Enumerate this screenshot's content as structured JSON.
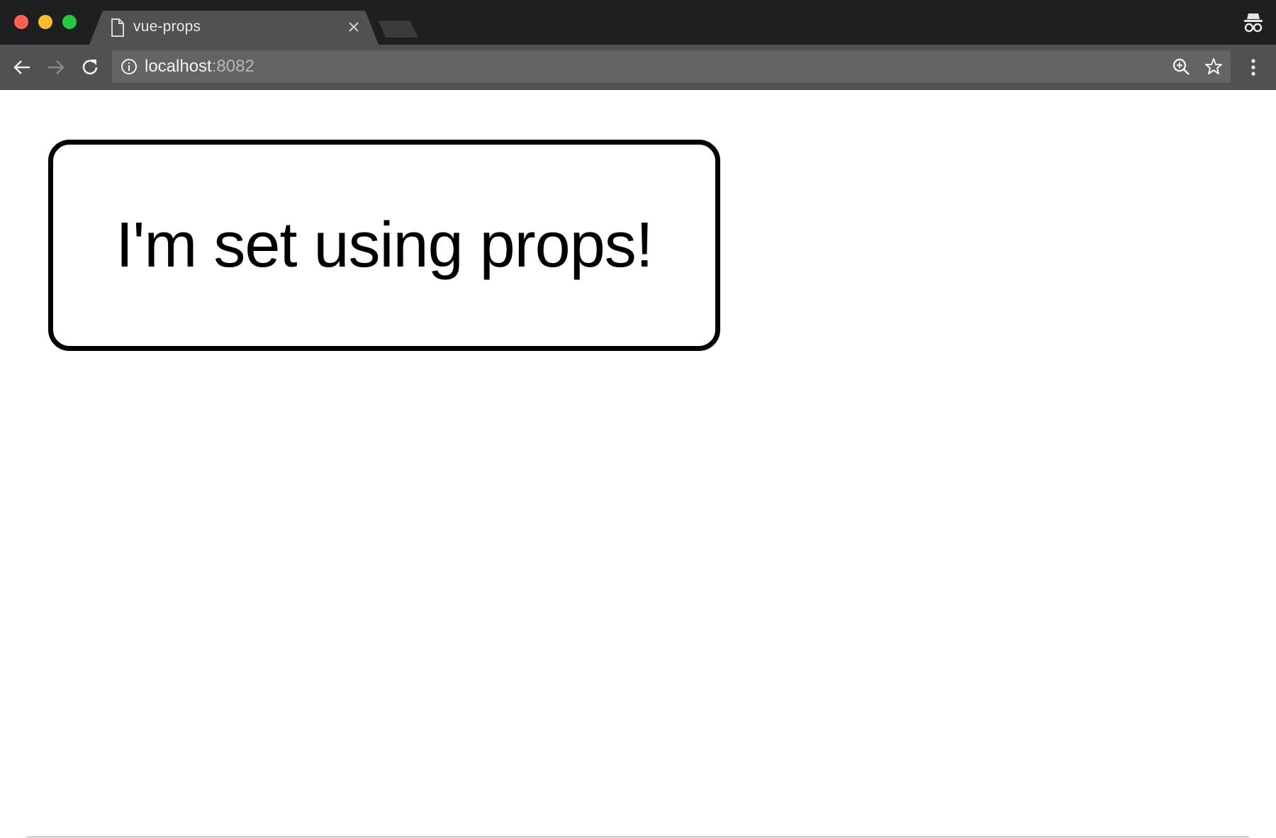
{
  "browser": {
    "tab": {
      "title": "vue-props"
    },
    "address": {
      "host": "localhost",
      "port": ":8082"
    },
    "colors": {
      "tabstrip": "#1e1f21",
      "toolbar": "#505153",
      "omnibox": "#636465",
      "close": "#fe5f57",
      "minimize": "#febc2e",
      "maximize": "#28c840"
    },
    "icons": [
      "file-icon",
      "close-icon",
      "back-arrow-icon",
      "forward-arrow-icon",
      "reload-icon",
      "info-icon",
      "zoom-icon",
      "star-icon",
      "menu-icon",
      "incognito-icon"
    ]
  },
  "page": {
    "message": "I'm set using props!"
  }
}
